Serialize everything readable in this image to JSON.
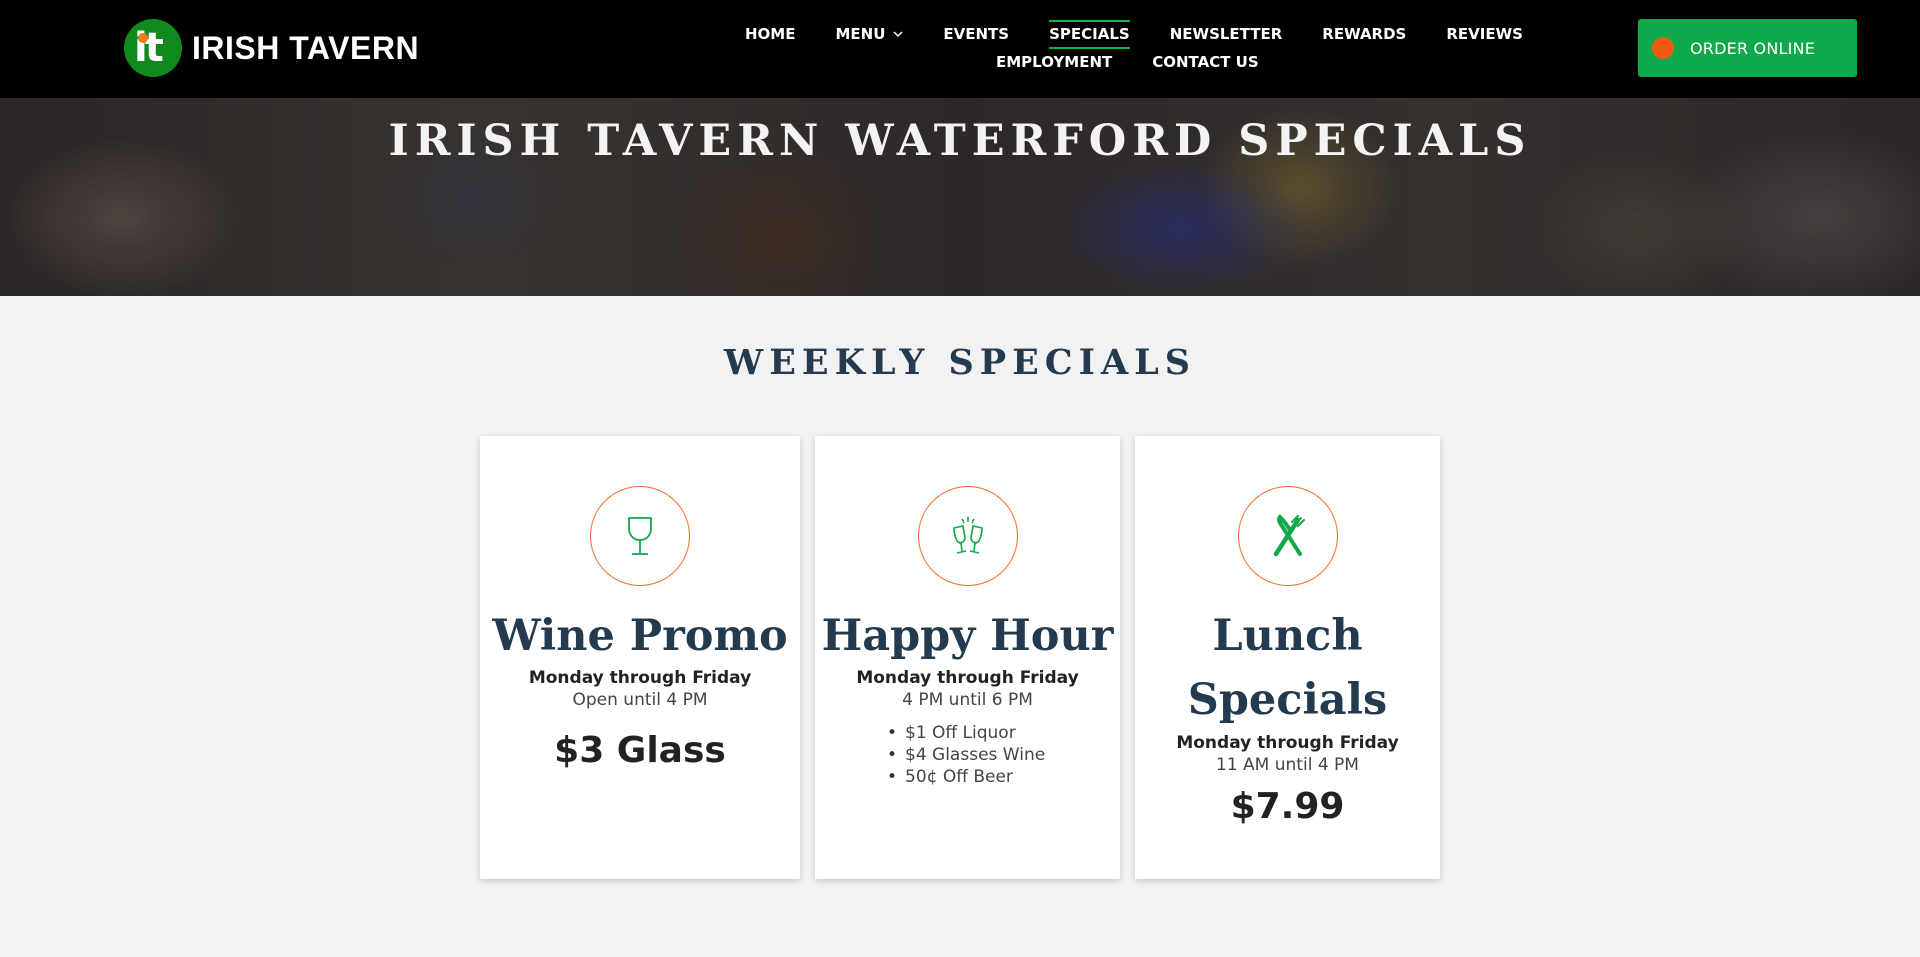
{
  "brand": {
    "logo_mark": "it",
    "name": "IRISH TAVERN"
  },
  "nav": {
    "row1": [
      "HOME",
      "MENU",
      "EVENTS",
      "SPECIALS",
      "NEWSLETTER",
      "REWARDS",
      "REVIEWS"
    ],
    "row2": [
      "EMPLOYMENT",
      "CONTACT US"
    ],
    "active": "SPECIALS"
  },
  "order_button": {
    "label": "ORDER ONLINE"
  },
  "hero": {
    "title": "IRISH TAVERN WATERFORD SPECIALS"
  },
  "section": {
    "title": "WEEKLY SPECIALS"
  },
  "cards": [
    {
      "icon": "wine-glass-icon",
      "title": "Wine Promo",
      "days": "Monday through Friday",
      "hours": "Open until 4 PM",
      "price": "$3 Glass"
    },
    {
      "icon": "cheers-glasses-icon",
      "title": "Happy Hour",
      "days": "Monday through Friday",
      "hours": "4 PM until 6 PM",
      "items": [
        "$1 Off Liquor",
        "$4 Glasses Wine",
        "50¢ Off Beer"
      ]
    },
    {
      "icon": "fork-knife-icon",
      "title": "Lunch Specials",
      "days": "Monday through Friday",
      "hours": "11 AM until 4 PM",
      "price": "$7.99"
    }
  ],
  "colors": {
    "header_bg": "#000000",
    "accent_green": "#0ea94a",
    "accent_orange": "#f0702a",
    "heading_navy": "#233a4f",
    "page_bg": "#f2f2f2"
  }
}
